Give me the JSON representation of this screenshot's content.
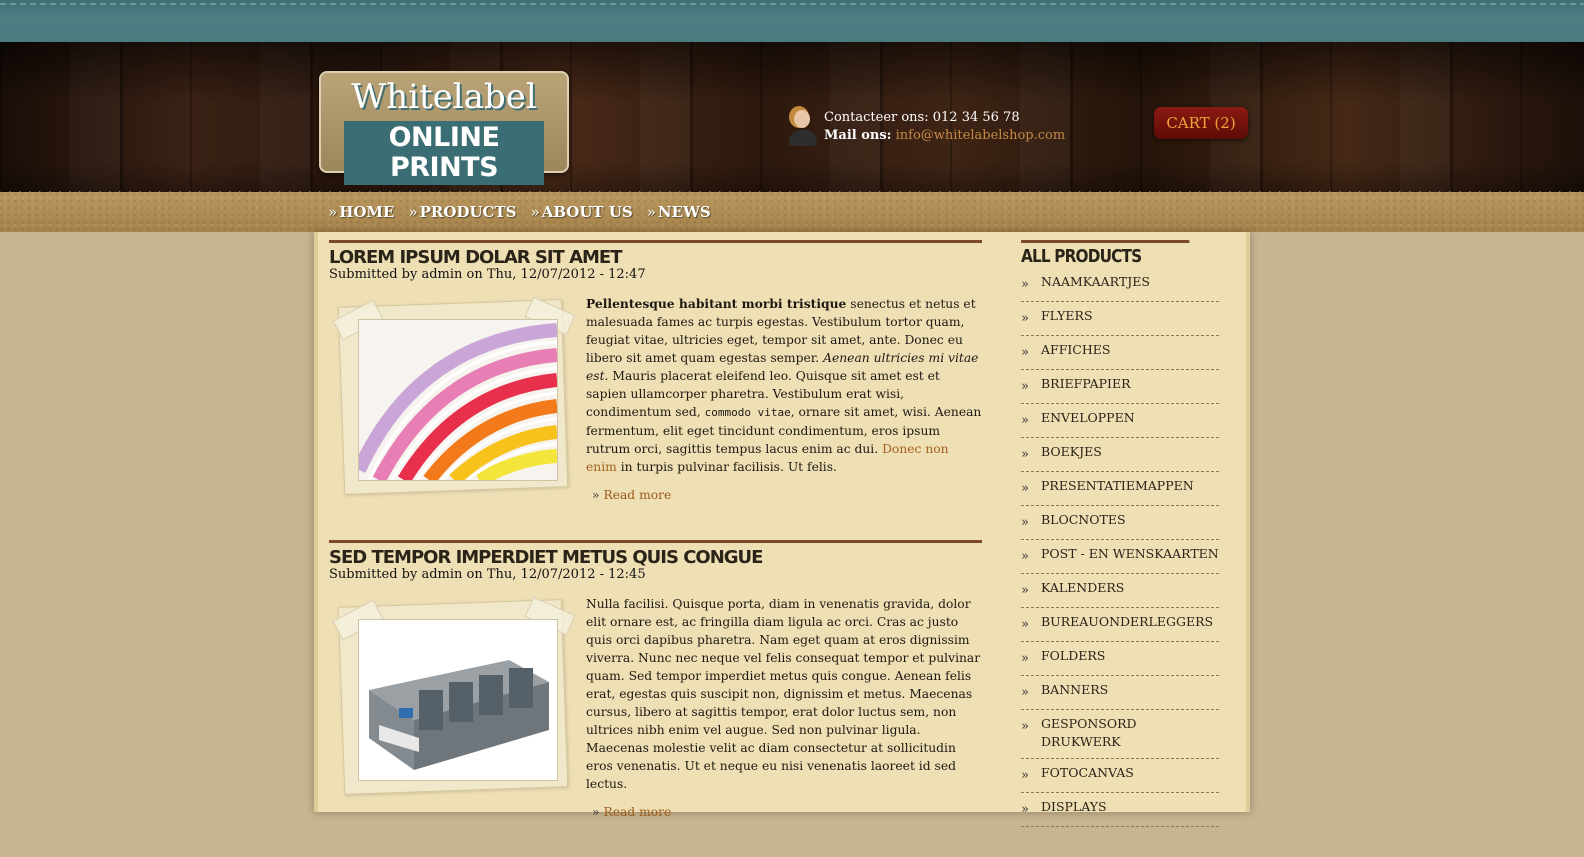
{
  "logo": {
    "line1": "Whitelabel",
    "line2": "ONLINE PRINTS"
  },
  "contact": {
    "phone_label": "Contacteer ons:",
    "phone": "012 34 56 78",
    "mail_label": "Mail ons:",
    "mail": "info@whitelabelshop.com"
  },
  "cart": {
    "label": "CART (2)"
  },
  "nav": [
    {
      "label": "HOME"
    },
    {
      "label": "PRODUCTS"
    },
    {
      "label": "ABOUT US"
    },
    {
      "label": "NEWS"
    }
  ],
  "articles": [
    {
      "title": "LOREM IPSUM DOLAR SIT AMET",
      "meta": "Submitted by admin on Thu, 12/07/2012 - 12:47",
      "bold_intro": "Pellentesque habitant morbi tristique",
      "p1": " senectus et netus et malesuada fames ac turpis egestas. Vestibulum tortor quam, feugiat vitae, ultricies eget, tempor sit amet, ante. Donec eu libero sit amet quam egestas semper. ",
      "italic": "Aenean ultricies mi vitae est.",
      "p2": " Mauris placerat eleifend leo. Quisque sit amet est et sapien ullamcorper pharetra. Vestibulum erat wisi, condimentum sed, ",
      "code": "commodo vitae",
      "p3": ", ornare sit amet, wisi. Aenean fermentum, elit eget tincidunt condimentum, eros ipsum rutrum orci, sagittis tempus lacus enim ac dui. ",
      "link": "Donec non enim",
      "p4": " in turpis pulvinar facilisis. Ut felis.",
      "read_more": "Read more"
    },
    {
      "title": "SED TEMPOR IMPERDIET METUS QUIS CONGUE",
      "meta": "Submitted by admin on Thu, 12/07/2012 - 12:45",
      "body": "Nulla facilisi. Quisque porta, diam in venenatis gravida, dolor elit ornare est, ac fringilla diam ligula ac orci. Cras ac justo quis orci dapibus pharetra. Nam eget quam at eros dignissim viverra. Nunc nec neque vel felis consequat tempor et pulvinar quam. Sed tempor imperdiet metus quis congue. Aenean felis erat, egestas quis suscipit non, dignissim et metus. Maecenas cursus, libero at sagittis tempor, erat dolor luctus sem, non ultrices nibh enim vel augue. Sed non pulvinar ligula. Maecenas molestie velit ac diam consectetur at sollicitudin eros venenatis. Ut et neque eu nisi venenatis laoreet id sed lectus.",
      "read_more": "Read more"
    }
  ],
  "sidebar": {
    "title": "ALL PRODUCTS",
    "items": [
      "NAAMKAARTJES",
      "FLYERS",
      "AFFICHES",
      "BRIEFPAPIER",
      "ENVELOPPEN",
      "BOEKJES",
      "PRESENTATIEMAPPEN",
      "BLOCNOTES",
      "POST - EN WENSKAARTEN",
      "KALENDERS",
      "BUREAUONDERLEGGERS",
      "FOLDERS",
      "BANNERS",
      "GESPONSORD DRUKWERK",
      "FOTOCANVAS",
      "DISPLAYS"
    ]
  },
  "colors": {
    "accent": "#a4601f",
    "cart_bg": "#7a140c",
    "teal": "#4b7a7f"
  }
}
